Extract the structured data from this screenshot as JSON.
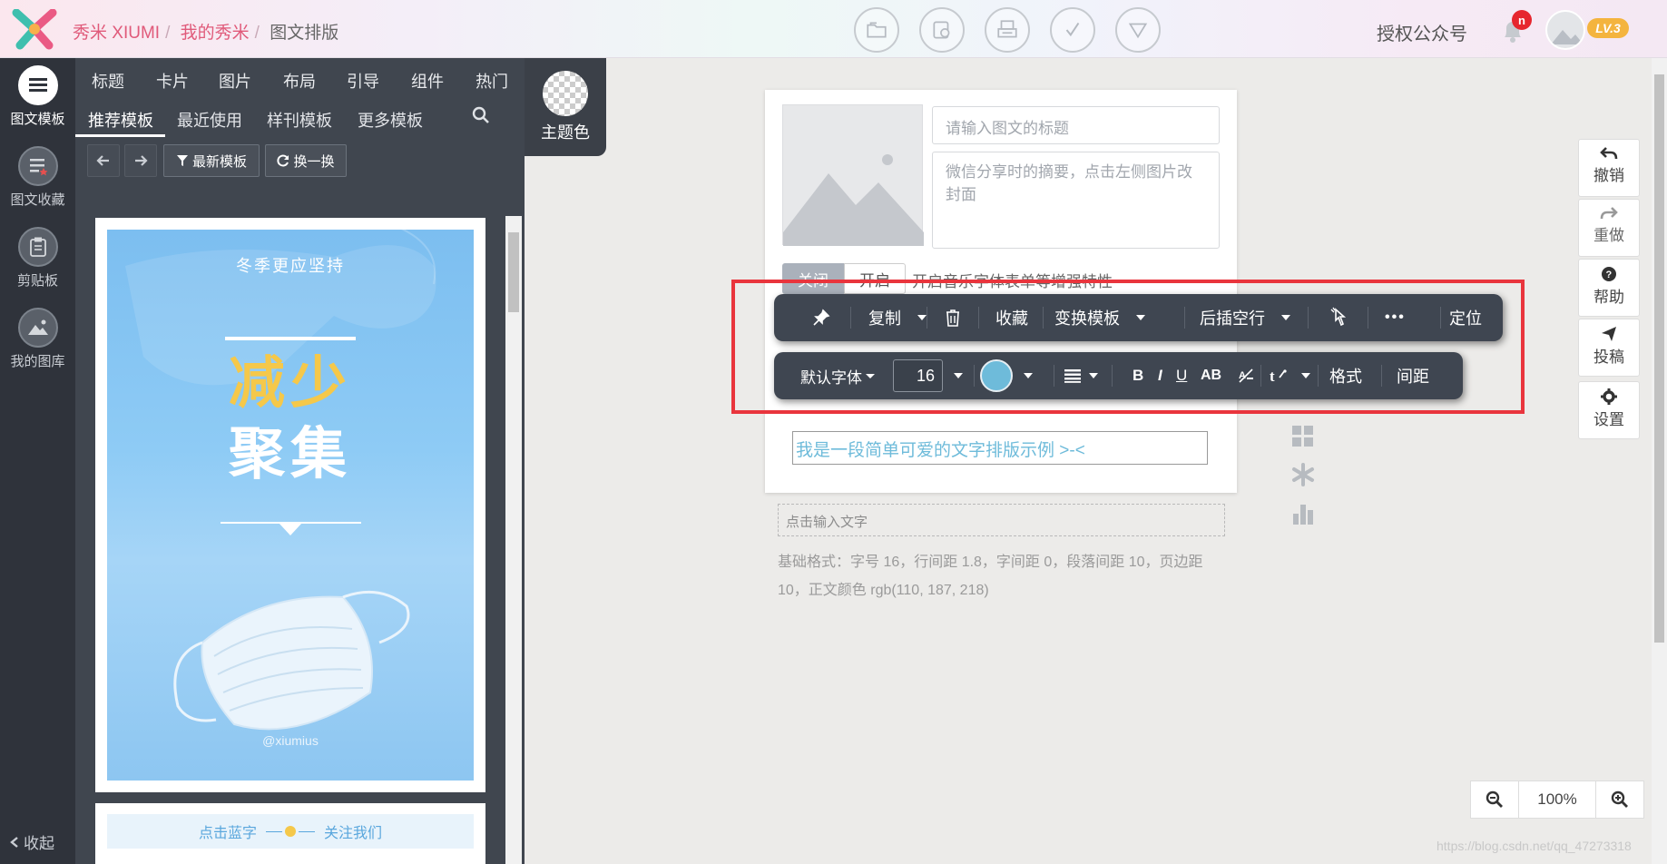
{
  "topbar": {
    "breadcrumb": [
      "秀米 XIUMI",
      "我的秀米",
      "图文排版"
    ],
    "right_link": "授权公众号",
    "notification_badge": "n",
    "level_badge": "LV.3",
    "tools": [
      "folder-icon",
      "camera-icon",
      "print-icon",
      "check-icon",
      "triangle-down-icon"
    ]
  },
  "rail": {
    "items": [
      "图文模板",
      "图文收藏",
      "剪贴板",
      "我的图库"
    ],
    "collapse": "收起"
  },
  "library": {
    "categories": [
      "标题",
      "卡片",
      "图片",
      "布局",
      "引导",
      "组件",
      "热门"
    ],
    "subtabs": [
      "推荐模板",
      "最近使用",
      "样刊模板",
      "更多模板"
    ],
    "buttons": [
      "最新模板",
      "换一换"
    ],
    "theme_color": "主题色",
    "poster": {
      "subtitle": "冬季更应坚持",
      "line1": "减少",
      "line2": "聚集",
      "handle": "@xiumius"
    },
    "follow_banner": {
      "left": "点击蓝字",
      "right": "关注我们"
    }
  },
  "editor": {
    "title_placeholder": "请输入图文的标题",
    "summary_placeholder": "微信分享时的摘要，点击左侧图片改封面",
    "toggle_off": "关闭",
    "toggle_on": "开启",
    "toggle_desc": "开启音乐字体表单等增强特性",
    "sample_text": "我是一段简单可爱的文字排版示例 >-<",
    "click_input": "点击输入文字",
    "base_format": "基础格式：字号 16，行间距 1.8，字间距 0，段落间距 10，页边距 10，正文颜色 rgb(110, 187, 218)"
  },
  "toolbar1": {
    "copy": "复制",
    "favorite": "收藏",
    "transform": "变换模板",
    "insert_after": "后插空行",
    "locate": "定位",
    "more": "•••"
  },
  "toolbar2": {
    "font": "默认字体",
    "size": "16",
    "color": "#6ebbda",
    "bold": "B",
    "italic": "I",
    "underline": "U",
    "caps": "AB",
    "format": "格式",
    "spacing": "间距"
  },
  "right_actions": [
    "撤销",
    "重做",
    "帮助",
    "投稿",
    "设置"
  ],
  "zoom": {
    "value": "100%"
  },
  "watermark": "https://blog.csdn.net/qq_47273318"
}
